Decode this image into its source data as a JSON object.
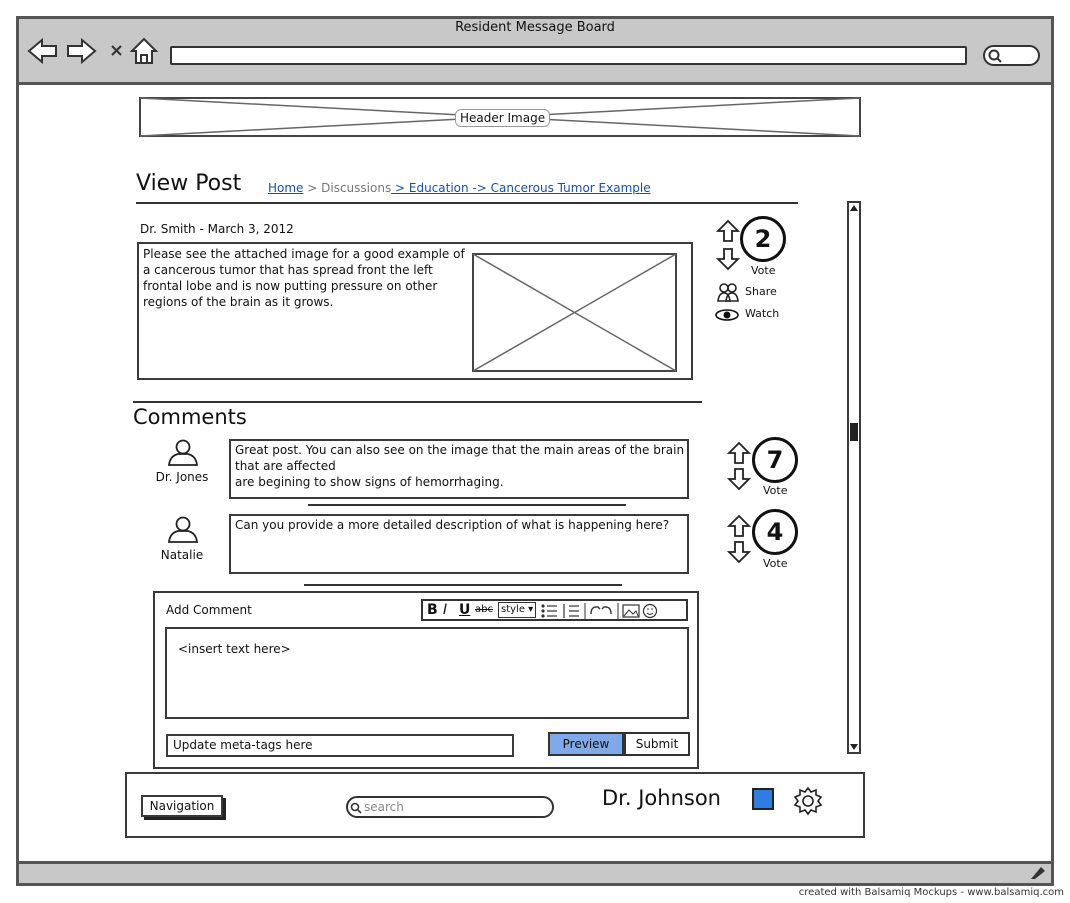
{
  "window": {
    "title": "Resident Message Board"
  },
  "header": {
    "image_label": "Header Image"
  },
  "page": {
    "title": "View Post",
    "breadcrumb": {
      "home": "Home",
      "sep1": " > ",
      "discussions": "Discussions",
      "rest": " > Education -> Cancerous Tumor Example"
    }
  },
  "post": {
    "meta": "Dr. Smith - March 3, 2012",
    "body": "Please see the attached image for a good example of a cancerous tumor that has spread front the left frontal lobe and is now putting pressure on other regions of the brain as it grows.",
    "votes": "2",
    "vote_label": "Vote",
    "share_label": "Share",
    "watch_label": "Watch"
  },
  "comments": {
    "heading": "Comments",
    "items": [
      {
        "author": "Dr. Jones",
        "line1": "Great post.  You can also see on the image that the main areas of the brain",
        "line2": "that are affected",
        "line3": "are begining to show signs of hemorrhaging.",
        "votes": "7",
        "vote_label": "Vote"
      },
      {
        "author": "Natalie",
        "line1": "Can you provide a more detailed description of what is happening here?",
        "votes": "4",
        "vote_label": "Vote"
      }
    ]
  },
  "add_comment": {
    "label": "Add Comment",
    "toolbar": {
      "bold": "B",
      "italic": "I",
      "underline": "U",
      "strike": "abc",
      "style": "style"
    },
    "placeholder": "<insert text here>",
    "meta_tags": "Update meta-tags here",
    "preview": "Preview",
    "submit": "Submit"
  },
  "footer": {
    "nav": "Navigation",
    "search_placeholder": "search",
    "user": "Dr. Johnson"
  },
  "credit": "created with Balsamiq Mockups - www.balsamiq.com",
  "colors": {
    "accent_button": "#7fa9e8",
    "blue_square": "#2f7de0",
    "chrome": "#c8c8c8"
  }
}
